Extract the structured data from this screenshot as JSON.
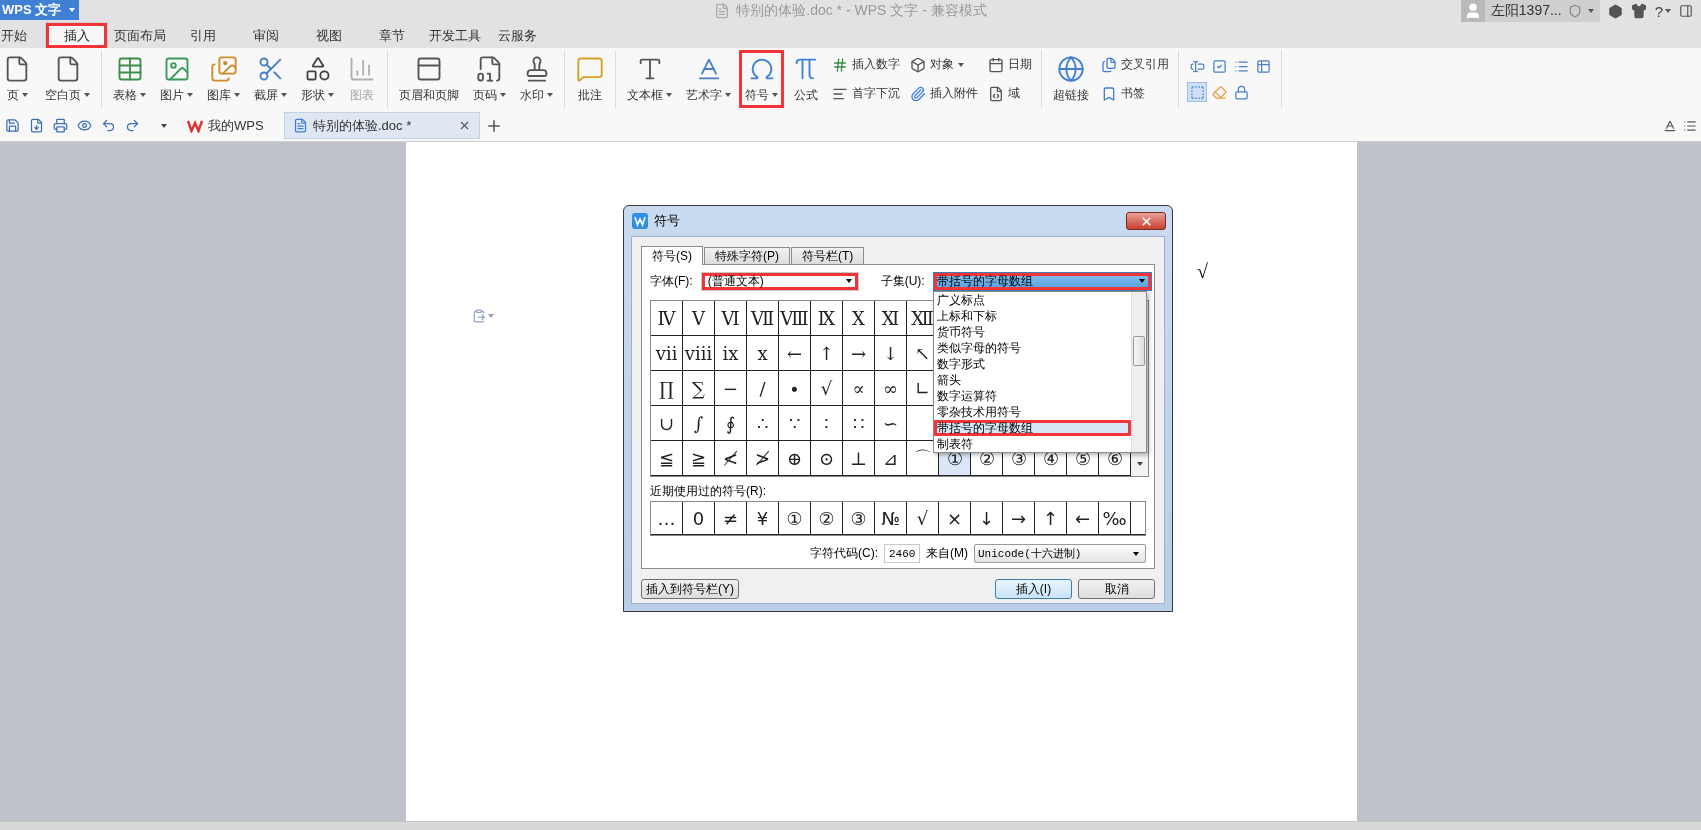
{
  "app_button": {
    "label": "WPS 文字"
  },
  "window": {
    "title": "特别的体验.doc * - WPS 文字 - 兼容模式"
  },
  "account": {
    "name": "左阳1397...",
    "help": "?"
  },
  "menu_tabs": [
    {
      "label": "开始",
      "selected": false,
      "highlighted": false
    },
    {
      "label": "插入",
      "selected": true,
      "highlighted": true
    },
    {
      "label": "页面布局",
      "selected": false,
      "highlighted": false
    },
    {
      "label": "引用",
      "selected": false,
      "highlighted": false
    },
    {
      "label": "审阅",
      "selected": false,
      "highlighted": false
    },
    {
      "label": "视图",
      "selected": false,
      "highlighted": false
    },
    {
      "label": "章节",
      "selected": false,
      "highlighted": false
    },
    {
      "label": "开发工具",
      "selected": false,
      "highlighted": false
    },
    {
      "label": "云服务",
      "selected": false,
      "highlighted": false
    }
  ],
  "ribbon": {
    "groups": [
      {
        "items": [
          {
            "kind": "large",
            "label": "页",
            "dropdown": true,
            "disabled": false,
            "highlighted": false
          },
          {
            "kind": "large",
            "label": "空白页",
            "dropdown": true,
            "disabled": false,
            "highlighted": false
          }
        ]
      },
      {
        "items": [
          {
            "kind": "large",
            "label": "表格",
            "dropdown": true,
            "disabled": false,
            "highlighted": false
          },
          {
            "kind": "large",
            "label": "图片",
            "dropdown": true,
            "disabled": false,
            "highlighted": false
          },
          {
            "kind": "large",
            "label": "图库",
            "dropdown": true,
            "disabled": false,
            "highlighted": false
          },
          {
            "kind": "large",
            "label": "截屏",
            "dropdown": true,
            "disabled": false,
            "highlighted": false
          },
          {
            "kind": "large",
            "label": "形状",
            "dropdown": true,
            "disabled": false,
            "highlighted": false
          },
          {
            "kind": "large",
            "label": "图表",
            "dropdown": false,
            "disabled": true,
            "highlighted": false
          }
        ]
      },
      {
        "items": [
          {
            "kind": "large",
            "label": "页眉和页脚",
            "dropdown": false,
            "disabled": false,
            "highlighted": false
          },
          {
            "kind": "large",
            "label": "页码",
            "dropdown": true,
            "disabled": false,
            "highlighted": false
          },
          {
            "kind": "large",
            "label": "水印",
            "dropdown": true,
            "disabled": false,
            "highlighted": false
          }
        ]
      },
      {
        "items": [
          {
            "kind": "large",
            "label": "批注",
            "dropdown": false,
            "disabled": false,
            "highlighted": false
          }
        ]
      },
      {
        "items": [
          {
            "kind": "large",
            "label": "文本框",
            "dropdown": true,
            "disabled": false,
            "highlighted": false
          },
          {
            "kind": "large",
            "label": "艺术字",
            "dropdown": true,
            "disabled": false,
            "highlighted": false
          },
          {
            "kind": "large",
            "label": "符号",
            "dropdown": true,
            "disabled": false,
            "highlighted": true
          },
          {
            "kind": "large",
            "label": "公式",
            "dropdown": false,
            "disabled": false,
            "highlighted": false
          },
          {
            "kind": "small",
            "label": "插入数字",
            "dropdown": false,
            "disabled": false,
            "highlighted": false
          },
          {
            "kind": "small",
            "label": "首字下沉",
            "dropdown": false,
            "disabled": false,
            "highlighted": false
          },
          {
            "kind": "small",
            "label": "对象",
            "dropdown": true,
            "disabled": false,
            "highlighted": false
          },
          {
            "kind": "small",
            "label": "插入附件",
            "dropdown": false,
            "disabled": false,
            "highlighted": false
          },
          {
            "kind": "small",
            "label": "日期",
            "dropdown": false,
            "disabled": false,
            "highlighted": false
          },
          {
            "kind": "small",
            "label": "域",
            "dropdown": false,
            "disabled": false,
            "highlighted": false
          }
        ]
      },
      {
        "items": [
          {
            "kind": "large",
            "label": "超链接",
            "dropdown": false,
            "disabled": false,
            "highlighted": false
          },
          {
            "kind": "small",
            "label": "交叉引用",
            "dropdown": false,
            "disabled": false,
            "highlighted": false
          },
          {
            "kind": "small",
            "label": "书签",
            "dropdown": false,
            "disabled": false,
            "highlighted": false
          }
        ]
      }
    ]
  },
  "form_tools": [
    {
      "selected": false
    },
    {
      "selected": false
    },
    {
      "selected": false
    },
    {
      "selected": false
    },
    {
      "selected": true
    },
    {
      "selected": false
    },
    {
      "selected": false
    }
  ],
  "doc_tabs": [
    {
      "label": "我的WPS",
      "selected": false
    },
    {
      "label": "特别的体验.doc *",
      "selected": true
    }
  ],
  "document": {
    "text": "√"
  },
  "dialog": {
    "title": "符号",
    "tabs": [
      {
        "label": "符号(S)",
        "selected": true
      },
      {
        "label": "特殊字符(P)",
        "selected": false
      },
      {
        "label": "符号栏(T)",
        "selected": false
      }
    ],
    "font": {
      "label": "字体(F):",
      "value": "(普通文本)",
      "highlighted": true
    },
    "subset": {
      "label": "子集(U):",
      "value": "带括号的字母数组",
      "highlighted": true,
      "expanded": true,
      "options": [
        {
          "label": "广义标点",
          "selected": false,
          "highlighted": false
        },
        {
          "label": "上标和下标",
          "selected": false,
          "highlighted": false
        },
        {
          "label": "货币符号",
          "selected": false,
          "highlighted": false
        },
        {
          "label": "类似字母的符号",
          "selected": false,
          "highlighted": false
        },
        {
          "label": "数字形式",
          "selected": false,
          "highlighted": false
        },
        {
          "label": "箭头",
          "selected": false,
          "highlighted": false
        },
        {
          "label": "数字运算符",
          "selected": false,
          "highlighted": false
        },
        {
          "label": "零杂技术用符号",
          "selected": false,
          "highlighted": false
        },
        {
          "label": "带括号的字母数组",
          "selected": true,
          "highlighted": true
        },
        {
          "label": "制表符",
          "selected": false,
          "highlighted": false
        }
      ]
    },
    "symbol_rows": [
      [
        {
          "char": "Ⅳ",
          "selected": false
        },
        {
          "char": "Ⅴ",
          "selected": false
        },
        {
          "char": "Ⅵ",
          "selected": false
        },
        {
          "char": "Ⅶ",
          "selected": false
        },
        {
          "char": "Ⅷ",
          "selected": false
        },
        {
          "char": "Ⅸ",
          "selected": false
        },
        {
          "char": "Ⅹ",
          "selected": false
        },
        {
          "char": "Ⅺ",
          "selected": false
        },
        {
          "char": "Ⅻ",
          "selected": false
        }
      ],
      [
        {
          "char": "ⅶ",
          "selected": false
        },
        {
          "char": "ⅷ",
          "selected": false
        },
        {
          "char": "ⅸ",
          "selected": false
        },
        {
          "char": "ⅹ",
          "selected": false
        },
        {
          "char": "←",
          "selected": false
        },
        {
          "char": "↑",
          "selected": false
        },
        {
          "char": "→",
          "selected": false
        },
        {
          "char": "↓",
          "selected": false
        },
        {
          "char": "↖",
          "selected": false
        }
      ],
      [
        {
          "char": "∏",
          "selected": false
        },
        {
          "char": "∑",
          "selected": false
        },
        {
          "char": "−",
          "selected": false
        },
        {
          "char": "∕",
          "selected": false
        },
        {
          "char": "∙",
          "selected": false
        },
        {
          "char": "√",
          "selected": false
        },
        {
          "char": "∝",
          "selected": false
        },
        {
          "char": "∞",
          "selected": false
        },
        {
          "char": "∟",
          "selected": false
        }
      ],
      [
        {
          "char": "∪",
          "selected": false
        },
        {
          "char": "∫",
          "selected": false
        },
        {
          "char": "∮",
          "selected": false
        },
        {
          "char": "∴",
          "selected": false
        },
        {
          "char": "∵",
          "selected": false
        },
        {
          "char": "∶",
          "selected": false
        },
        {
          "char": "∷",
          "selected": false
        },
        {
          "char": "∽",
          "selected": false
        }
      ],
      [
        {
          "char": "≦",
          "selected": false
        },
        {
          "char": "≧",
          "selected": false
        },
        {
          "char": "≮",
          "selected": false
        },
        {
          "char": "≯",
          "selected": false
        },
        {
          "char": "⊕",
          "selected": false
        },
        {
          "char": "⊙",
          "selected": false
        },
        {
          "char": "⊥",
          "selected": false
        },
        {
          "char": "⊿",
          "selected": false
        },
        {
          "char": "⌒",
          "selected": false
        },
        {
          "char": "①",
          "selected": true
        },
        {
          "char": "②",
          "selected": false
        },
        {
          "char": "③",
          "selected": false
        },
        {
          "char": "④",
          "selected": false
        },
        {
          "char": "⑤",
          "selected": false
        },
        {
          "char": "⑥",
          "selected": false
        }
      ]
    ],
    "recent_label": "近期使用过的符号(R):",
    "recent": [
      "…",
      "0",
      "≠",
      "¥",
      "①",
      "②",
      "③",
      "№",
      "√",
      "×",
      "↓",
      "→",
      "↑",
      "←",
      "‰"
    ],
    "code_label": "字符代码(C):",
    "code_value": "2460",
    "from_label": "来自(M)",
    "from_value": "Unicode(十六进制)",
    "buttons": [
      {
        "label": "插入到符号栏(Y)",
        "kind": "secondary"
      },
      {
        "label": "插入(I)",
        "kind": "default"
      },
      {
        "label": "取消",
        "kind": "normal"
      }
    ]
  }
}
